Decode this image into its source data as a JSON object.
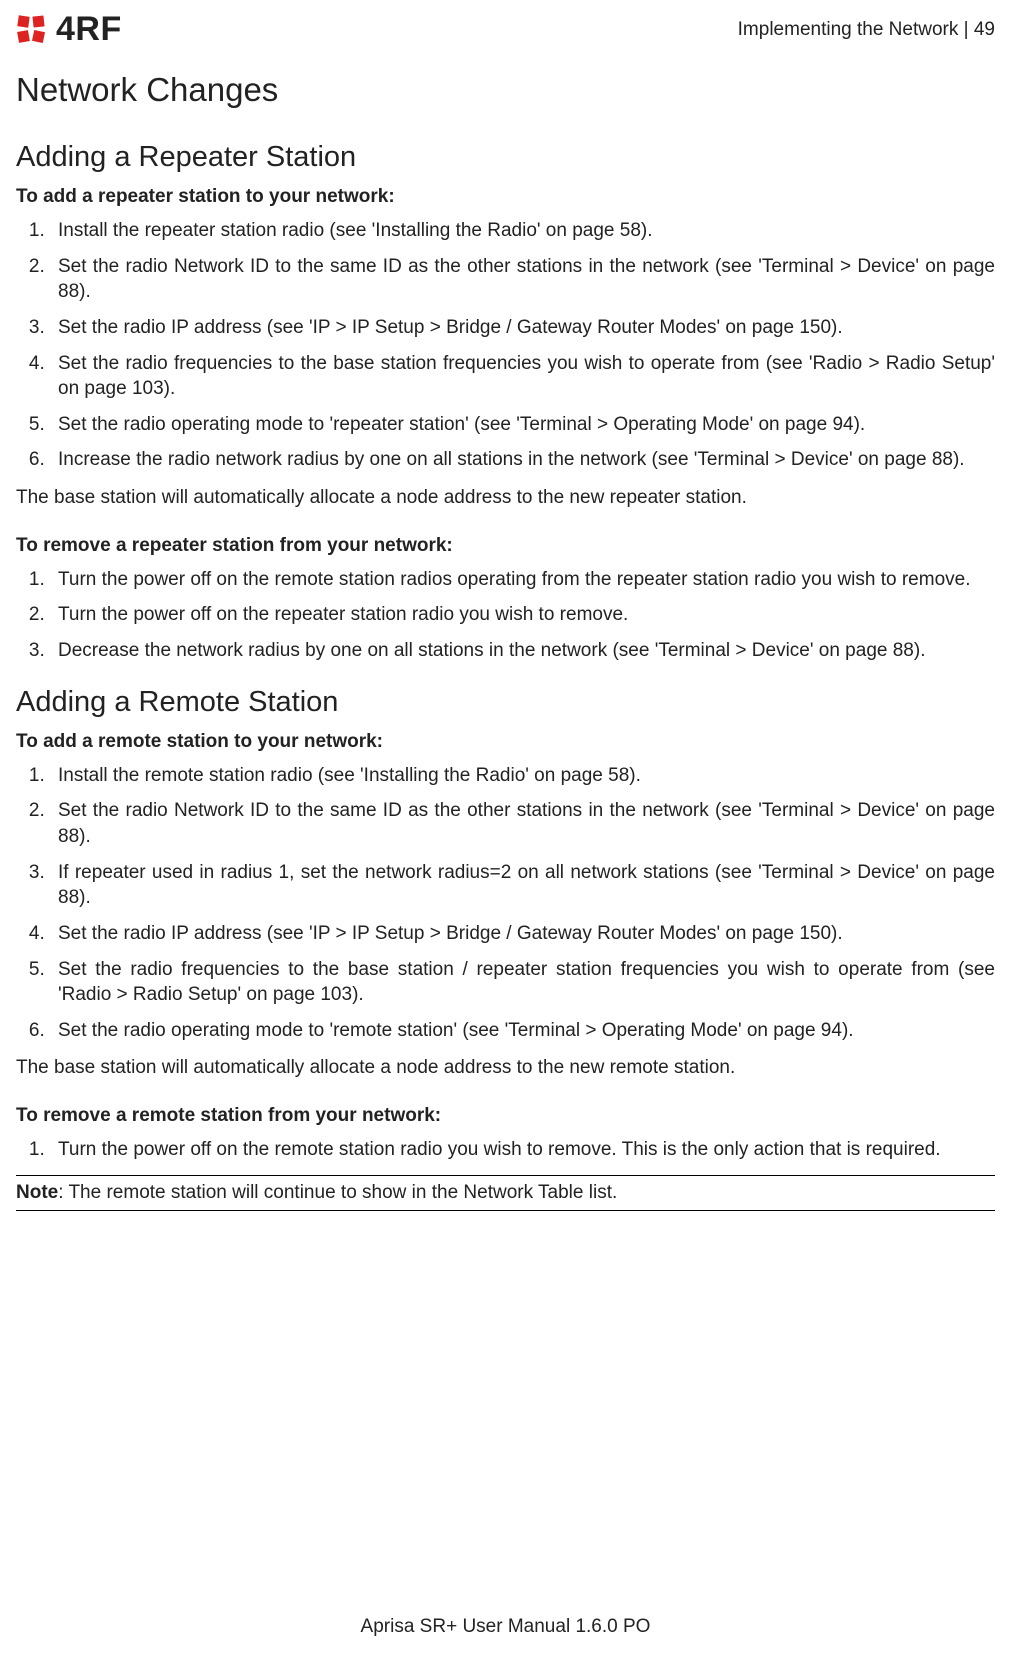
{
  "header": {
    "logo_text": "4RF",
    "section_label": "Implementing the Network  |  49"
  },
  "title": "Network Changes",
  "sections": [
    {
      "heading": "Adding a Repeater Station",
      "intro_add": "To add a repeater station to your network:",
      "steps_add": [
        "Install the repeater station radio (see 'Installing the Radio' on page 58).",
        "Set the radio Network ID to the same ID as the other stations in the network (see 'Terminal > Device' on page 88).",
        "Set the radio IP address (see 'IP > IP Setup > Bridge / Gateway Router Modes' on page 150).",
        "Set the radio frequencies to the base station frequencies you wish to operate from (see 'Radio > Radio Setup' on page 103).",
        "Set the radio operating mode to 'repeater station' (see 'Terminal > Operating Mode' on page 94).",
        "Increase the radio network radius by one on all stations in the network (see 'Terminal > Device' on page 88)."
      ],
      "after_add": "The base station will automatically allocate a node address to the new repeater station.",
      "intro_remove": "To remove a repeater station from your network:",
      "steps_remove": [
        "Turn the power off on the remote station radios operating from the repeater station radio you wish to remove.",
        "Turn the power off on the repeater station radio you wish to remove.",
        "Decrease the network radius by one on all stations in the network (see 'Terminal > Device' on page 88)."
      ]
    },
    {
      "heading": "Adding a Remote Station",
      "intro_add": "To add a remote station to your network:",
      "steps_add": [
        "Install the remote station radio (see 'Installing the Radio' on page 58).",
        "Set the radio Network ID to the same ID as the other stations in the network (see 'Terminal > Device' on page 88).",
        "If repeater used in radius 1, set the network radius=2 on all network stations (see 'Terminal > Device' on page 88).",
        "Set the radio IP address (see 'IP > IP Setup > Bridge / Gateway Router Modes' on page 150).",
        "Set the radio frequencies to the base station / repeater station frequencies you wish to operate from (see 'Radio > Radio Setup' on page 103).",
        "Set the radio operating mode to 'remote station' (see 'Terminal > Operating Mode' on page 94)."
      ],
      "after_add": "The base station will automatically allocate a node address to the new remote station.",
      "intro_remove": "To remove a remote station from your network:",
      "steps_remove": [
        "Turn the power off on the remote station radio you wish to remove. This is the only action that is required."
      ],
      "note_label": "Note",
      "note_text": ": The remote station will continue to show in the Network Table list."
    }
  ],
  "footer": "Aprisa SR+ User Manual 1.6.0 PO"
}
